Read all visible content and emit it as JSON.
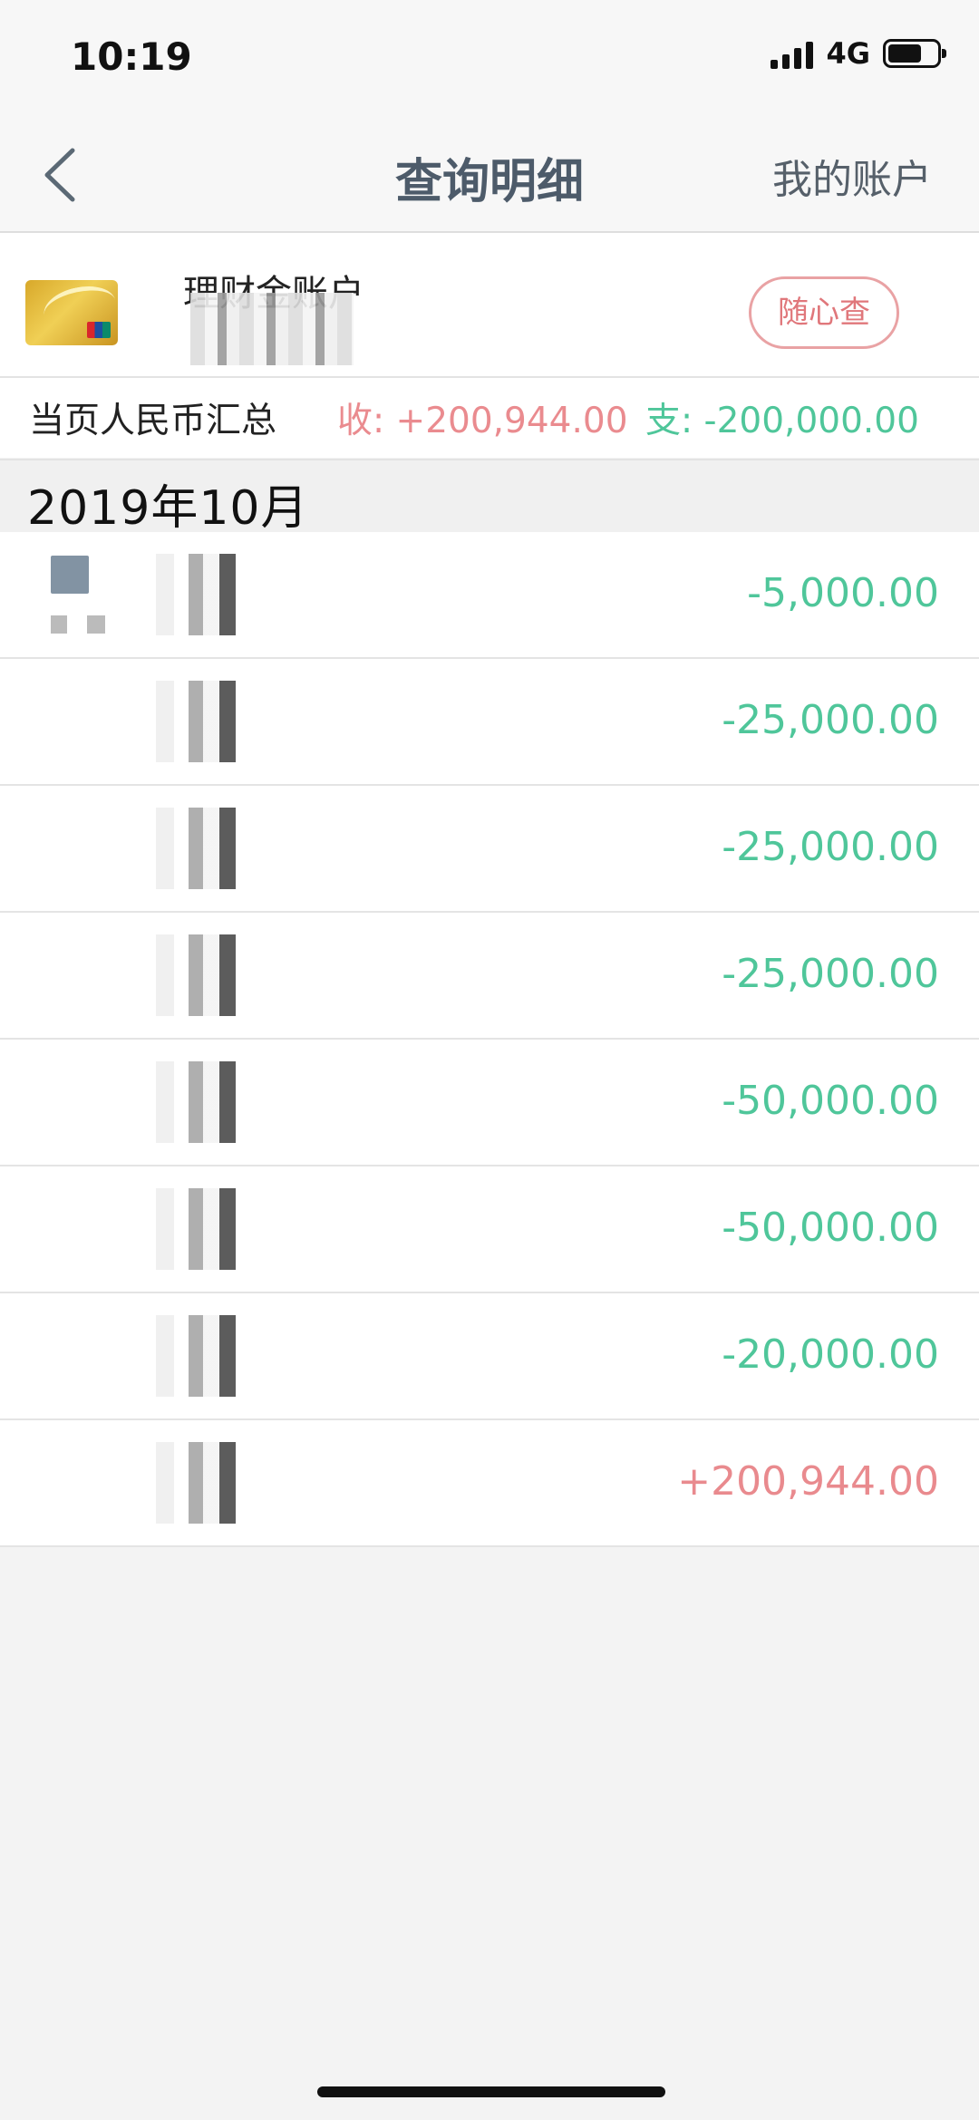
{
  "status_bar": {
    "time": "10:19",
    "network": "4G"
  },
  "nav": {
    "title": "查询明细",
    "right_label": "我的账户"
  },
  "account": {
    "name": "理财金账户",
    "query_button": "随心查"
  },
  "summary": {
    "label": "当页人民币汇总",
    "income": "收: +200,944.00",
    "expense": "支: -200,000.00"
  },
  "month": "2019年10月",
  "transactions": [
    {
      "amount": "-5,000.00"
    },
    {
      "amount": "-25,000.00"
    },
    {
      "amount": "-25,000.00"
    },
    {
      "amount": "-25,000.00"
    },
    {
      "amount": "-50,000.00"
    },
    {
      "amount": "-50,000.00"
    },
    {
      "amount": "-20,000.00"
    },
    {
      "amount": "+200,944.00"
    }
  ],
  "colors": {
    "income": "#e98a8e",
    "expense": "#4fc69a",
    "title": "#4d5b6a"
  },
  "icons": {
    "back": "chevron-left-icon",
    "signal": "signal-icon",
    "battery": "battery-icon",
    "card": "bank-card-icon"
  }
}
